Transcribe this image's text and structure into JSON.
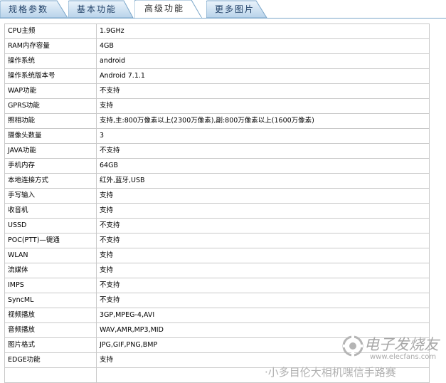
{
  "tabs": [
    {
      "label": "规格参数",
      "active": false
    },
    {
      "label": "基本功能",
      "active": false
    },
    {
      "label": "高级功能",
      "active": true
    },
    {
      "label": "更多图片",
      "active": false
    }
  ],
  "specs": [
    {
      "k": "CPU主频",
      "v": "1.9GHz"
    },
    {
      "k": "RAM内存容量",
      "v": "4GB"
    },
    {
      "k": "操作系统",
      "v": "android"
    },
    {
      "k": "操作系统版本号",
      "v": "Android 7.1.1"
    },
    {
      "k": "WAP功能",
      "v": "不支持"
    },
    {
      "k": "GPRS功能",
      "v": "支持"
    },
    {
      "k": "照相功能",
      "v": "支持,主:800万像素以上(2300万像素),副:800万像素以上(1600万像素)"
    },
    {
      "k": "摄像头数量",
      "v": "3"
    },
    {
      "k": "JAVA功能",
      "v": "不支持"
    },
    {
      "k": "手机内存",
      "v": "64GB"
    },
    {
      "k": "本地连接方式",
      "v": "红外,蓝牙,USB"
    },
    {
      "k": "手写输入",
      "v": "支持"
    },
    {
      "k": "收音机",
      "v": "支持"
    },
    {
      "k": "USSD",
      "v": "不支持"
    },
    {
      "k": "POC(PTT)—键通",
      "v": "不支持"
    },
    {
      "k": "WLAN",
      "v": "支持"
    },
    {
      "k": "流媒体",
      "v": "支持"
    },
    {
      "k": "IMPS",
      "v": "不支持"
    },
    {
      "k": "SyncML",
      "v": "不支持"
    },
    {
      "k": "视频播放",
      "v": "3GP,MPEG-4,AVI"
    },
    {
      "k": "音频播放",
      "v": "WAV,AMR,MP3,MID"
    },
    {
      "k": "图片格式",
      "v": "JPG,GIF,PNG,BMP"
    },
    {
      "k": "EDGE功能",
      "v": "支持"
    },
    {
      "k": "",
      "v": ""
    }
  ],
  "watermark": {
    "text": "电子发烧友",
    "url": "www.elecfans.com"
  },
  "footer": "·小多目伦大相机嘿信手路赛"
}
